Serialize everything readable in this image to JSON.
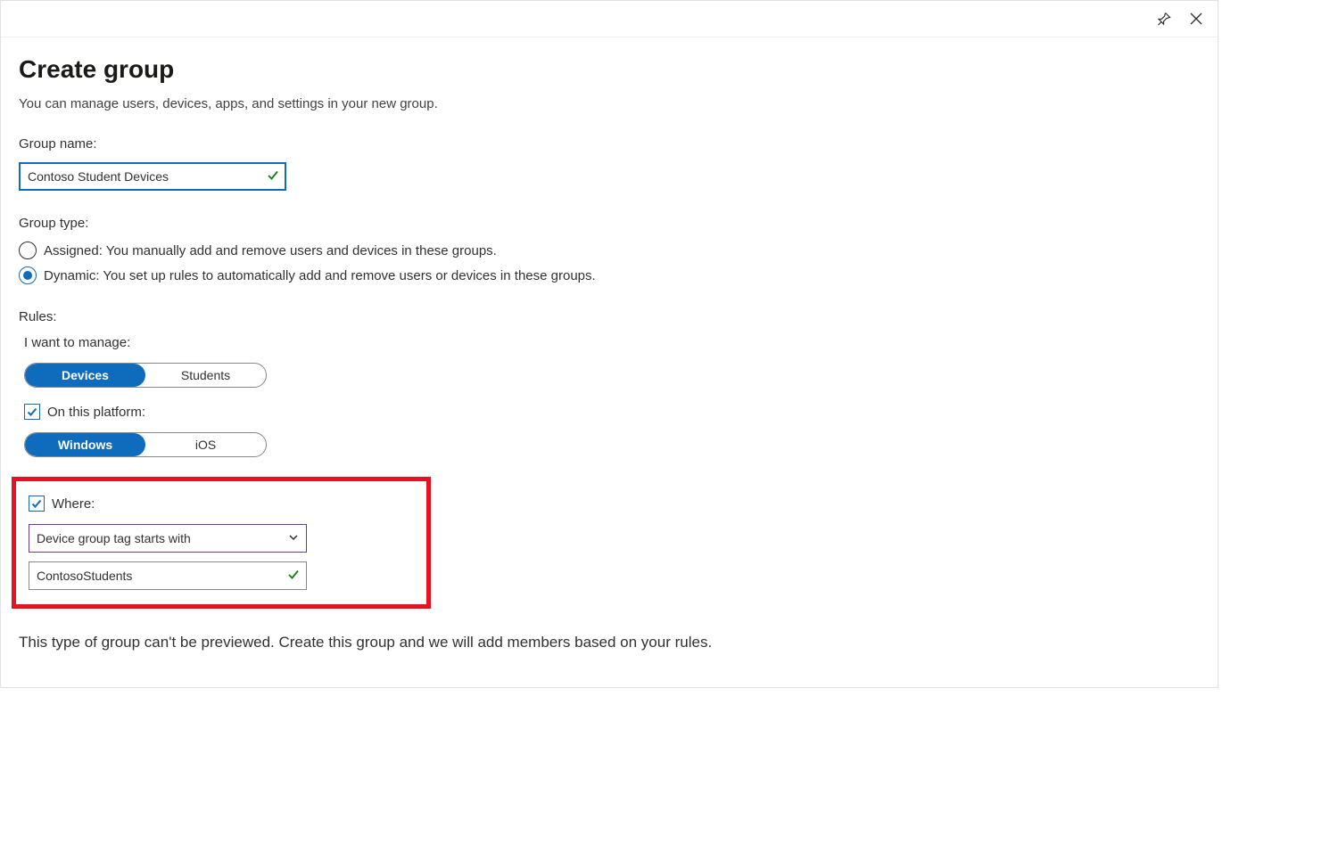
{
  "header": {
    "title": "Create group",
    "description": "You can manage users, devices, apps, and settings in your new group."
  },
  "groupName": {
    "label": "Group name:",
    "value": "Contoso Student Devices"
  },
  "groupType": {
    "label": "Group type:",
    "options": {
      "assigned": "Assigned: You manually add and remove users and devices in these groups.",
      "dynamic": "Dynamic: You set up rules to automatically add and remove users or devices in these groups."
    }
  },
  "rules": {
    "label": "Rules:",
    "manageLabel": "I want to manage:",
    "manageOptions": {
      "devices": "Devices",
      "students": "Students"
    },
    "platformLabel": "On this platform:",
    "platformOptions": {
      "windows": "Windows",
      "ios": "iOS"
    },
    "whereLabel": "Where:",
    "whereCondition": "Device group tag starts with",
    "whereValue": "ContosoStudents"
  },
  "footer": "This type of group can't be previewed. Create this group and we will add members based on your rules."
}
